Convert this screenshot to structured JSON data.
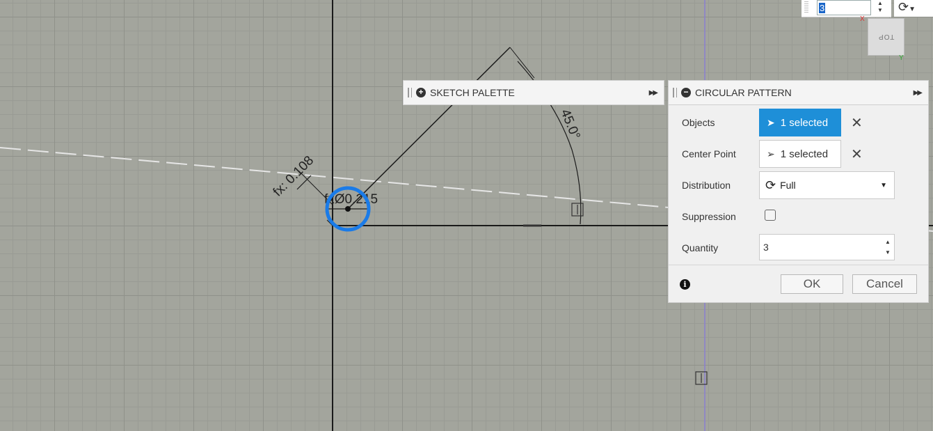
{
  "viewport": {
    "dimensions": {
      "fx_offset": "fx: 0.108",
      "diameter": "fxØ0.215",
      "angle": "45.0°"
    }
  },
  "quick_input": {
    "value": "3"
  },
  "viewcube": {
    "face_label": "TOP",
    "axis_x": "X",
    "axis_y": "Y"
  },
  "sketch_palette": {
    "title": "SKETCH PALETTE",
    "expand_icon": "double-arrow-right"
  },
  "circular_pattern": {
    "title": "CIRCULAR PATTERN",
    "objects": {
      "label": "Objects",
      "value": "1 selected",
      "active": true
    },
    "center_point": {
      "label": "Center Point",
      "value": "1 selected",
      "active": false
    },
    "distribution": {
      "label": "Distribution",
      "value": "Full"
    },
    "suppression": {
      "label": "Suppression",
      "checked": false
    },
    "quantity": {
      "label": "Quantity",
      "value": "3"
    },
    "ok_label": "OK",
    "cancel_label": "Cancel"
  },
  "colors": {
    "accent": "#1e8fd8",
    "selection_ring": "#1a7be8",
    "axis_line": "#8a7fd0"
  }
}
